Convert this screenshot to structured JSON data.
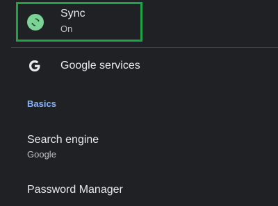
{
  "sync": {
    "title": "Sync",
    "status": "On",
    "icon": "sync-icon",
    "icon_color": "#7bd395"
  },
  "google_services": {
    "label": "Google services",
    "icon": "google-g-icon"
  },
  "basics": {
    "header": "Basics"
  },
  "search_engine": {
    "title": "Search engine",
    "value": "Google"
  },
  "password_manager": {
    "title": "Password Manager"
  },
  "colors": {
    "background": "#202124",
    "accent": "#8ab4f8",
    "highlight": "#1ea446"
  }
}
